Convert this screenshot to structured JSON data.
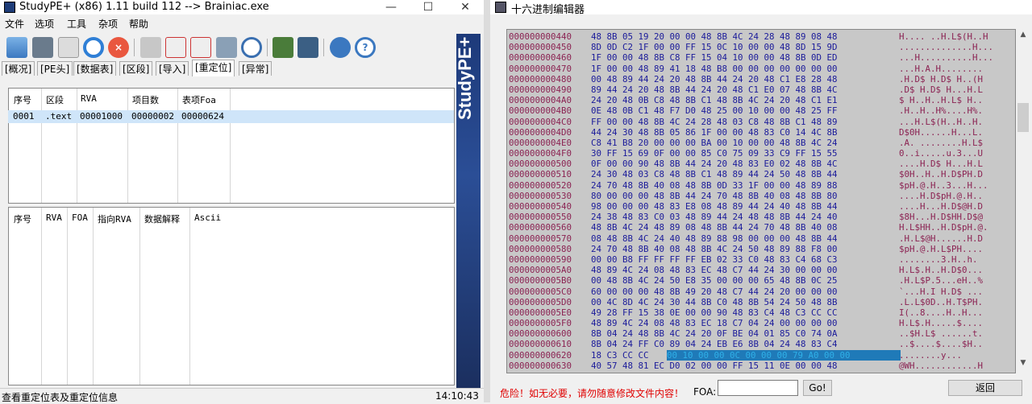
{
  "left_window": {
    "title": "StudyPE+ (x86) 1.11 build 112  --> Brainiac.exe",
    "menu": [
      "文件",
      "选项",
      "工具",
      "杂项",
      "帮助"
    ],
    "toolbar_icons": [
      "open-icon",
      "save-icon",
      "report-icon",
      "refresh-icon",
      "close-icon",
      "database-icon",
      "asm-icon",
      "asm2-icon",
      "calculator-icon",
      "search-icon",
      "image-icon",
      "compare-icon",
      "gear-icon",
      "help-icon"
    ],
    "tabs": [
      "[概况]",
      "[PE头]",
      "[数据表]",
      "[区段]",
      "[导入]",
      "[重定位]",
      "[异常]"
    ],
    "active_tab": 5,
    "reloc_table": {
      "headers": [
        "序号",
        "区段",
        "RVA",
        "项目数",
        "表项Foa"
      ],
      "rows": [
        [
          "0001",
          ".text",
          "00001000",
          "00000002",
          "00000624"
        ]
      ]
    },
    "entries_table": {
      "headers": [
        "序号",
        "RVA",
        "FOA",
        "指向RVA",
        "数据解释",
        "Ascii"
      ]
    },
    "banner": "StudyPE+",
    "status": "查看重定位表及重定位信息",
    "time": "14:10:43"
  },
  "hex_window": {
    "title": "十六进制编辑器",
    "rows": [
      {
        "a": "000000000440",
        "b": "48 8B 05 19 20 00 00 48 8B 4C 24 28 48 89 08 48",
        "s": "H.... ..H.L$(H..H"
      },
      {
        "a": "000000000450",
        "b": "8D 0D C2 1F 00 00 FF 15 0C 10 00 00 48 8D 15 9D",
        "s": "..............H..."
      },
      {
        "a": "000000000460",
        "b": "1F 00 00 48 8B C8 FF 15 04 10 00 00 48 8B 0D ED",
        "s": "...H..........H..."
      },
      {
        "a": "000000000470",
        "b": "1F 00 00 48 89 41 18 48 B8 00 00 00 00 00 00 00",
        "s": "...H.A.H........"
      },
      {
        "a": "000000000480",
        "b": "00 48 89 44 24 20 48 8B 44 24 20 48 C1 E8 28 48",
        "s": ".H.D$ H.D$ H..(H"
      },
      {
        "a": "000000000490",
        "b": "89 44 24 20 48 8B 44 24 20 48 C1 E0 07 48 8B 4C",
        "s": ".D$ H.D$ H...H.L"
      },
      {
        "a": "0000000004A0",
        "b": "24 20 48 0B C8 48 8B C1 48 8B 4C 24 20 48 C1 E1",
        "s": "$ H..H..H.L$ H.."
      },
      {
        "a": "0000000004B0",
        "b": "0E 48 0B C1 48 F7 D0 48 25 00 10 00 00 48 25 FF",
        "s": ".H..H..H%....H%."
      },
      {
        "a": "0000000004C0",
        "b": "FF 00 00 48 8B 4C 24 28 48 03 C8 48 8B C1 48 89",
        "s": "...H.L$(H..H..H."
      },
      {
        "a": "0000000004D0",
        "b": "44 24 30 48 8B 05 86 1F 00 00 48 83 C0 14 4C 8B",
        "s": "D$0H......H...L."
      },
      {
        "a": "0000000004E0",
        "b": "C8 41 B8 20 00 00 00 BA 00 10 00 00 48 8B 4C 24",
        "s": ".A. ........H.L$"
      },
      {
        "a": "0000000004F0",
        "b": "30 FF 15 69 0F 00 00 85 C0 75 09 33 C9 FF 15 55",
        "s": "0..i.....u.3...U"
      },
      {
        "a": "000000000500",
        "b": "0F 00 00 90 48 8B 44 24 20 48 83 E0 02 48 8B 4C",
        "s": "....H.D$ H...H.L"
      },
      {
        "a": "000000000510",
        "b": "24 30 48 03 C8 48 8B C1 48 89 44 24 50 48 8B 44",
        "s": "$0H..H..H.D$PH.D"
      },
      {
        "a": "000000000520",
        "b": "24 70 48 8B 40 08 48 8B 0D 33 1F 00 00 48 89 88",
        "s": "$pH.@.H..3...H..."
      },
      {
        "a": "000000000530",
        "b": "80 00 00 00 48 8B 44 24 70 48 8B 40 08 48 8B 80",
        "s": "....H.D$pH.@.H.."
      },
      {
        "a": "000000000540",
        "b": "98 00 00 00 48 83 E8 08 48 89 44 24 40 48 8B 44",
        "s": "....H...H.D$@H.D"
      },
      {
        "a": "000000000550",
        "b": "24 38 48 83 C0 03 48 89 44 24 48 48 8B 44 24 40",
        "s": "$8H...H.D$HH.D$@"
      },
      {
        "a": "000000000560",
        "b": "48 8B 4C 24 48 89 08 48 8B 44 24 70 48 8B 40 08",
        "s": "H.L$HH..H.D$pH.@."
      },
      {
        "a": "000000000570",
        "b": "08 48 8B 4C 24 40 48 89 88 98 00 00 00 48 8B 44",
        "s": ".H.L$@H......H.D"
      },
      {
        "a": "000000000580",
        "b": "24 70 48 8B 40 08 48 8B 4C 24 50 48 89 88 F8 00",
        "s": "$pH.@.H.L$PH...."
      },
      {
        "a": "000000000590",
        "b": "00 00 B8 FF FF FF FF EB 02 33 C0 48 83 C4 68 C3",
        "s": "........3.H..h."
      },
      {
        "a": "0000000005A0",
        "b": "48 89 4C 24 08 48 83 EC 48 C7 44 24 30 00 00 00",
        "s": "H.L$.H..H.D$0..."
      },
      {
        "a": "0000000005B0",
        "b": "00 48 8B 4C 24 50 E8 35 00 00 00 65 48 8B 0C 25",
        "s": ".H.L$P.5...eH..%"
      },
      {
        "a": "0000000005C0",
        "b": "60 00 00 00 48 8B 49 20 48 C7 44 24 20 00 00 00",
        "s": "`...H.I H.D$ ..."
      },
      {
        "a": "0000000005D0",
        "b": "00 4C 8D 4C 24 30 44 8B C0 48 8B 54 24 50 48 8B",
        "s": ".L.L$0D..H.T$PH."
      },
      {
        "a": "0000000005E0",
        "b": "49 28 FF 15 38 0E 00 00 90 48 83 C4 48 C3 CC CC",
        "s": "I(..8....H..H..."
      },
      {
        "a": "0000000005F0",
        "b": "48 89 4C 24 08 48 83 EC 18 C7 04 24 00 00 00 00",
        "s": "H.L$.H.....$...."
      },
      {
        "a": "000000000600",
        "b": "8B 04 24 48 8B 4C 24 20 0F BE 04 01 85 C0 74 0A",
        "s": "..$H.L$ ......t."
      },
      {
        "a": "000000000610",
        "b": "8B 04 24 FF C0 89 04 24 EB E6 8B 04 24 48 83 C4",
        "s": "..$....$....$H.."
      },
      {
        "a": "000000000620",
        "b": "18 C3 CC CC 00 10 00 00 0C 00 00 00 79 A0 00 00",
        "s": "........y..."
      },
      {
        "a": "000000000630",
        "b": "40 57 48 81 EC D0 02 00 00 FF 15 11 0E 00 00 48",
        "s": "@WH............H"
      }
    ],
    "selected_row": 30,
    "selected_bytes": "00 10 00 00 0C 00 00 00 79 A0 00 00",
    "warning": "危险！如无必要，请勿随意修改文件内容！",
    "foa_label": "FOA:",
    "foa_value": "",
    "go_label": "Go!",
    "back_label": "返回"
  }
}
